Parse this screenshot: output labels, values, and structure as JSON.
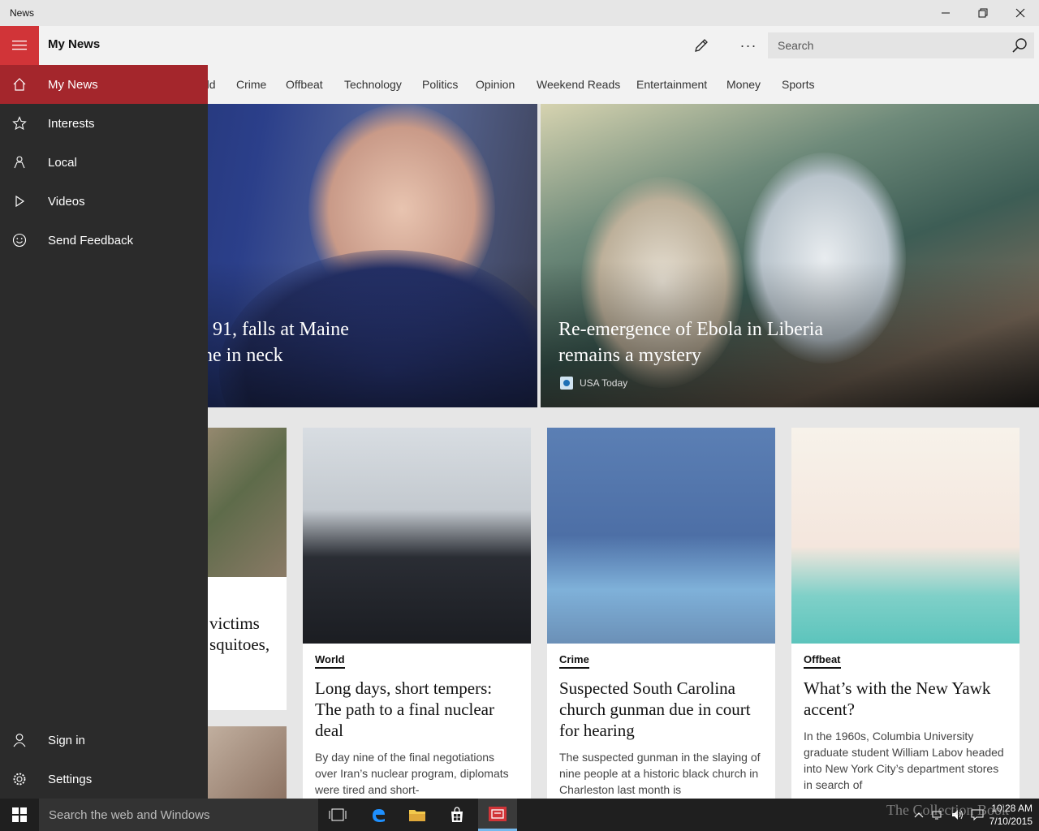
{
  "window": {
    "title": "News",
    "minimize_icon": "minimize-icon",
    "maximize_icon": "restore-icon",
    "close_icon": "close-icon"
  },
  "header": {
    "title": "My News",
    "search_placeholder": "Search",
    "more_label": "···",
    "accent_color": "#d13438"
  },
  "categories": [
    "rld",
    "Crime",
    "Offbeat",
    "Technology",
    "Politics",
    "Opinion",
    "Weekend Reads",
    "Entertainment",
    "Money",
    "Sports"
  ],
  "nav": {
    "items": [
      {
        "label": "My News",
        "icon": "home-icon",
        "active": true
      },
      {
        "label": "Interests",
        "icon": "star-icon",
        "active": false
      },
      {
        "label": "Local",
        "icon": "local-icon",
        "active": false
      },
      {
        "label": "Videos",
        "icon": "play-icon",
        "active": false
      },
      {
        "label": "Send Feedback",
        "icon": "smiley-icon",
        "active": false
      }
    ],
    "bottom": [
      {
        "label": "Sign in",
        "icon": "person-icon"
      },
      {
        "label": "Settings",
        "icon": "gear-icon"
      }
    ]
  },
  "hero": [
    {
      "headline_line1": ", 91, falls at Maine",
      "headline_line2": "ne in neck"
    },
    {
      "headline_line1": "Re-emergence of Ebola in Liberia",
      "headline_line2": "remains a mystery",
      "source": "USA Today"
    }
  ],
  "partial_card": {
    "line1": "victims",
    "line2": "squitoes,"
  },
  "cards": [
    {
      "category": "World",
      "title": "Long days, short tempers: The path to a final nuclear deal",
      "summary": "By day nine of the final negotiations over Iran’s nuclear program, diplomats were tired and short-"
    },
    {
      "category": "Crime",
      "title": "Suspected South Carolina church gunman due in court for hearing",
      "summary": "The suspected gunman in the slaying of nine people at a historic black church in Charleston last month is"
    },
    {
      "category": "Offbeat",
      "title": "What’s with the New Yawk accent?",
      "summary": "In the 1960s, Columbia University graduate student William Labov headed into New York City’s department stores in search of"
    }
  ],
  "taskbar": {
    "search_placeholder": "Search the web and Windows",
    "time": "10:28 AM",
    "date": "7/10/2015",
    "watermark": "The Collection Book"
  }
}
